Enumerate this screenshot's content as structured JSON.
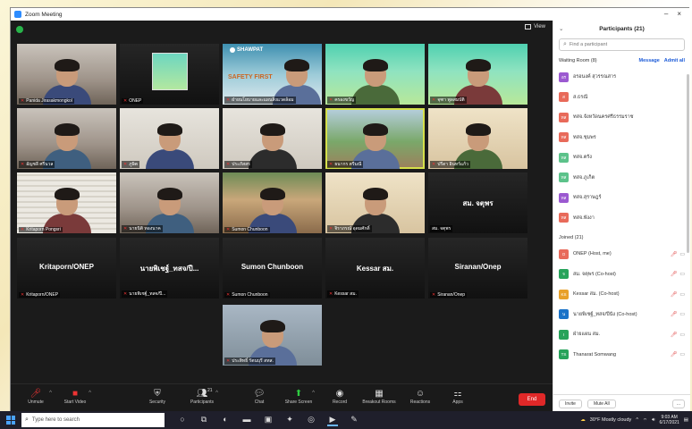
{
  "window": {
    "title": "Zoom Meeting",
    "view_label": "View"
  },
  "tiles": [
    {
      "name": "Panida Jirasakmongkol",
      "style": "v-room",
      "muted": true
    },
    {
      "name": "ONEP",
      "style": "v-dark",
      "muted": true,
      "poster": true
    },
    {
      "name": "ฝ่ายนโยบายและแผนสิ่งแวดล้อม",
      "style": "v-slide",
      "muted": true,
      "slide_brand": "SHAWPAT",
      "slide_text": "SAFETY FIRST"
    },
    {
      "name": "ครองขวัญ",
      "style": "v-green",
      "muted": true
    },
    {
      "name": "จุฑา พูลสมบัติ",
      "style": "v-green",
      "muted": true
    },
    {
      "name": "อัญชลี ศรีนวล",
      "style": "v-room",
      "muted": true
    },
    {
      "name": "ภูษิต",
      "style": "v-white",
      "muted": true
    },
    {
      "name": "ประภัสสร",
      "style": "v-white",
      "muted": true
    },
    {
      "name": "ธนากร ตรีมณี",
      "style": "v-tree",
      "muted": true,
      "active": true
    },
    {
      "name": "ปรีดา อินทร์แก้ว",
      "style": "v-wall",
      "muted": true
    },
    {
      "name": "Kritaporn Pongsri",
      "style": "v-blind",
      "muted": true
    },
    {
      "name": "นายนิติ ทองนาค",
      "style": "v-room",
      "muted": true
    },
    {
      "name": "Sumon Chunboon",
      "style": "v-yard",
      "muted": true
    },
    {
      "name": "จิราภรณ์ อุดมศักดิ์",
      "style": "v-wall",
      "muted": true
    },
    {
      "name": "สม. จตุพร",
      "style": "v-dark",
      "muted": false,
      "big": "สม. จตุพร"
    },
    {
      "name": "Kritaporn/ONEP",
      "style": "v-dark",
      "muted": true,
      "big": "Kritaporn/ONEP"
    },
    {
      "name": "นายพิเชฐ์_ทสจ/ปี...",
      "style": "v-dark",
      "muted": true,
      "big": "นายพิเชฐ์_ทสจ/ปี..."
    },
    {
      "name": "Sumon Chunboon",
      "style": "v-dark",
      "muted": true,
      "big": "Sumon Chunboon"
    },
    {
      "name": "Kessar สม.",
      "style": "v-dark",
      "muted": true,
      "big": "Kessar สม."
    },
    {
      "name": "Siranan/Onep",
      "style": "v-dark",
      "muted": true,
      "big": "Siranan/Onep"
    },
    {
      "name": "ประสิทธิ์ รัตนบุรี สทส.",
      "style": "v-office",
      "muted": true
    }
  ],
  "toolbar": {
    "unmute": "Unmute",
    "start_video": "Start Video",
    "security": "Security",
    "participants": "Participants",
    "participants_count": "21",
    "chat": "Chat",
    "share_screen": "Share Screen",
    "record": "Record",
    "breakout": "Breakout Rooms",
    "reactions": "Reactions",
    "apps": "Apps",
    "end": "End"
  },
  "panel": {
    "title": "Participants (21)",
    "search_placeholder": "Find a participant",
    "waiting_label": "Waiting Room (8)",
    "message": "Message",
    "admit_all": "Admit all",
    "joined_label": "Joined (21)",
    "invite": "Invite",
    "mute_all": "Mute All",
    "more": "...",
    "waiting": [
      {
        "initials": "อร",
        "name": "อรอนงค์ สุวรรณสาร",
        "color": "#9b59d0"
      },
      {
        "initials": "ส",
        "name": "ส.ธรณี",
        "color": "#e86a5a"
      },
      {
        "initials": "ทส",
        "name": "ทสจ.จังหวัดนครศรีธรรมราช",
        "color": "#e86a5a"
      },
      {
        "initials": "ทส",
        "name": "ทสจ.ชุมพร",
        "color": "#e86a5a"
      },
      {
        "initials": "ทส",
        "name": "ทสจ.ตรัง",
        "color": "#5cc28a"
      },
      {
        "initials": "ทส",
        "name": "ทสจ.ภูเก็ต",
        "color": "#5cc28a"
      },
      {
        "initials": "ทส",
        "name": "ทสจ.สุราษฎร์",
        "color": "#9b59d0"
      },
      {
        "initials": "ทส",
        "name": "ทสจ.พังงา",
        "color": "#e86a5a"
      }
    ],
    "joined": [
      {
        "initials": "O",
        "name": "ONEP (Host, me)",
        "color": "#e86a5a"
      },
      {
        "initials": "จ",
        "name": "สม. จตุพร (Co-host)",
        "color": "#27a35a"
      },
      {
        "initials": "KS",
        "name": "Kessar สม. (Co-host)",
        "color": "#e8a12a"
      },
      {
        "initials": "น",
        "name": "นายพิเชฐ์_ทสจ/ปีนัง (Co-host)",
        "color": "#1a73c8"
      },
      {
        "initials": "I",
        "name": "ฝ่ายแผน สม.",
        "color": "#27a35a"
      },
      {
        "initials": "TS",
        "name": "Thanarat Somwang",
        "color": "#27a35a"
      }
    ]
  },
  "taskbar": {
    "search_placeholder": "Type here to search",
    "weather": "30°F  Mostly cloudy",
    "time": "9:03 AM",
    "date": "6/17/2021"
  }
}
